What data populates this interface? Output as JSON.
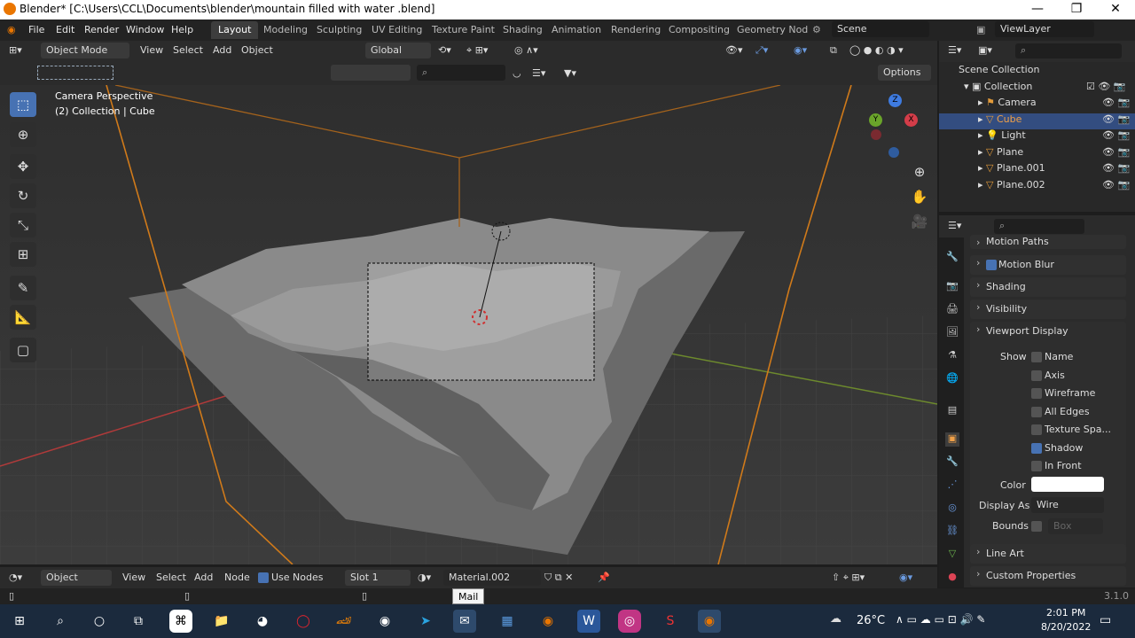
{
  "title": "Blender* [C:\\Users\\CCL\\Documents\\blender\\mountain filled with water .blend]",
  "window_controls": {
    "minimize": "—",
    "restore": "❐",
    "close": "✕"
  },
  "menu": [
    "File",
    "Edit",
    "Render",
    "Window",
    "Help"
  ],
  "workspaces": [
    "Layout",
    "Modeling",
    "Sculpting",
    "UV Editing",
    "Texture Paint",
    "Shading",
    "Animation",
    "Rendering",
    "Compositing",
    "Geometry Nod"
  ],
  "scene": "Scene",
  "view_layer": "ViewLayer",
  "viewport_header": {
    "mode": "Object Mode",
    "items": [
      "View",
      "Select",
      "Add",
      "Object"
    ],
    "transform": "Global",
    "options": "Options"
  },
  "viewport": {
    "camera_text": "Camera Perspective",
    "collection_text": "(2) Collection | Cube"
  },
  "gizmo": {
    "z": "Z",
    "y": "Y",
    "x": "X"
  },
  "outliner": {
    "root": "Scene Collection",
    "collection": "Collection",
    "items": [
      {
        "name": "Camera",
        "selected": false
      },
      {
        "name": "Cube",
        "selected": true
      },
      {
        "name": "Light",
        "selected": false
      },
      {
        "name": "Plane",
        "selected": false
      },
      {
        "name": "Plane.001",
        "selected": false
      },
      {
        "name": "Plane.002",
        "selected": false
      }
    ]
  },
  "properties": {
    "sections": [
      "Motion Paths",
      "Motion Blur",
      "Shading",
      "Visibility",
      "Viewport Display"
    ],
    "show_label": "Show",
    "show_options": [
      {
        "label": "Name",
        "checked": false
      },
      {
        "label": "Axis",
        "checked": false
      },
      {
        "label": "Wireframe",
        "checked": false
      },
      {
        "label": "All Edges",
        "checked": false
      },
      {
        "label": "Texture Spa...",
        "checked": false
      },
      {
        "label": "Shadow",
        "checked": true
      },
      {
        "label": "In Front",
        "checked": false
      }
    ],
    "color_label": "Color",
    "color_value": "#ffffff",
    "display_as_label": "Display As",
    "display_as": "Wire",
    "bounds_label": "Bounds",
    "bounds_value": "Box",
    "bottom_sections": [
      "Line Art",
      "Custom Properties"
    ]
  },
  "shader_header": {
    "editor": "Object",
    "items": [
      "View",
      "Select",
      "Add",
      "Node"
    ],
    "use_nodes": "Use Nodes",
    "slot": "Slot 1",
    "material": "Material.002"
  },
  "tooltip": "Mail",
  "version": "3.1.0",
  "taskbar": {
    "temperature": "26°C",
    "time": "2:01 PM",
    "date": "8/20/2022"
  },
  "colors": {
    "accent": "#4772b3",
    "selection_orange": "#ea7600",
    "header": "#2b2b2b"
  }
}
